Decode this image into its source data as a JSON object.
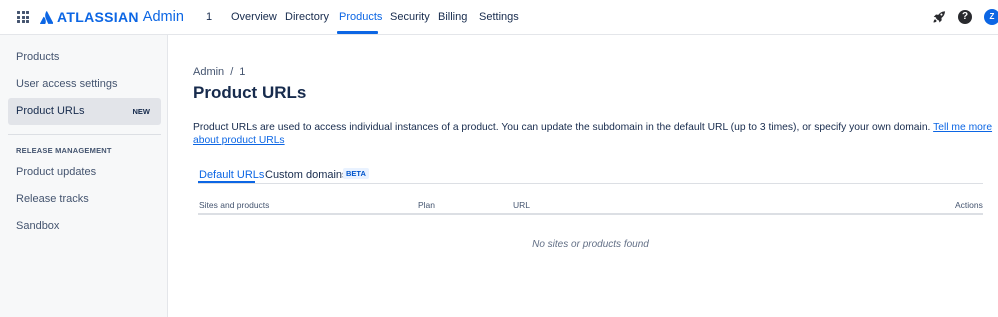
{
  "topnav": {
    "logo_text": "ATLASSIAN",
    "logo_product": "Admin",
    "org_id": "1",
    "links": [
      "Overview",
      "Directory",
      "Products",
      "Security",
      "Billing",
      "Settings"
    ],
    "active_link": "Products",
    "avatar_initial": "Z",
    "help_glyph": "?"
  },
  "sidebar": {
    "items": [
      {
        "label": "Products"
      },
      {
        "label": "User access settings"
      },
      {
        "label": "Product URLs",
        "badge": "NEW"
      }
    ],
    "section_title": "RELEASE MANAGEMENT",
    "section_items": [
      {
        "label": "Product updates"
      },
      {
        "label": "Release tracks"
      },
      {
        "label": "Sandbox"
      }
    ]
  },
  "main": {
    "breadcrumb": {
      "root": "Admin",
      "separator": "/",
      "current": "1"
    },
    "title": "Product URLs",
    "description": "Product URLs are used to access individual instances of a product. You can update the subdomain in the default URL (up to 3 times), or specify your own domain.",
    "description_link": "Tell me more about product URLs",
    "tabs": [
      {
        "label": "Default URLs"
      },
      {
        "label": "Custom domains"
      }
    ],
    "beta_badge": "BETA",
    "table": {
      "columns": [
        "Sites and products",
        "Plan",
        "URL",
        "Actions"
      ],
      "empty_text": "No sites or products found"
    }
  },
  "colors": {
    "accent": "#0c66e4",
    "text": "#172b4d",
    "subtle_text": "#44546f",
    "sidebar_bg": "#f7f8f9"
  },
  "icons": [
    "app-switcher-icon",
    "atlassian-logo-icon",
    "rocket-icon",
    "help-icon"
  ]
}
